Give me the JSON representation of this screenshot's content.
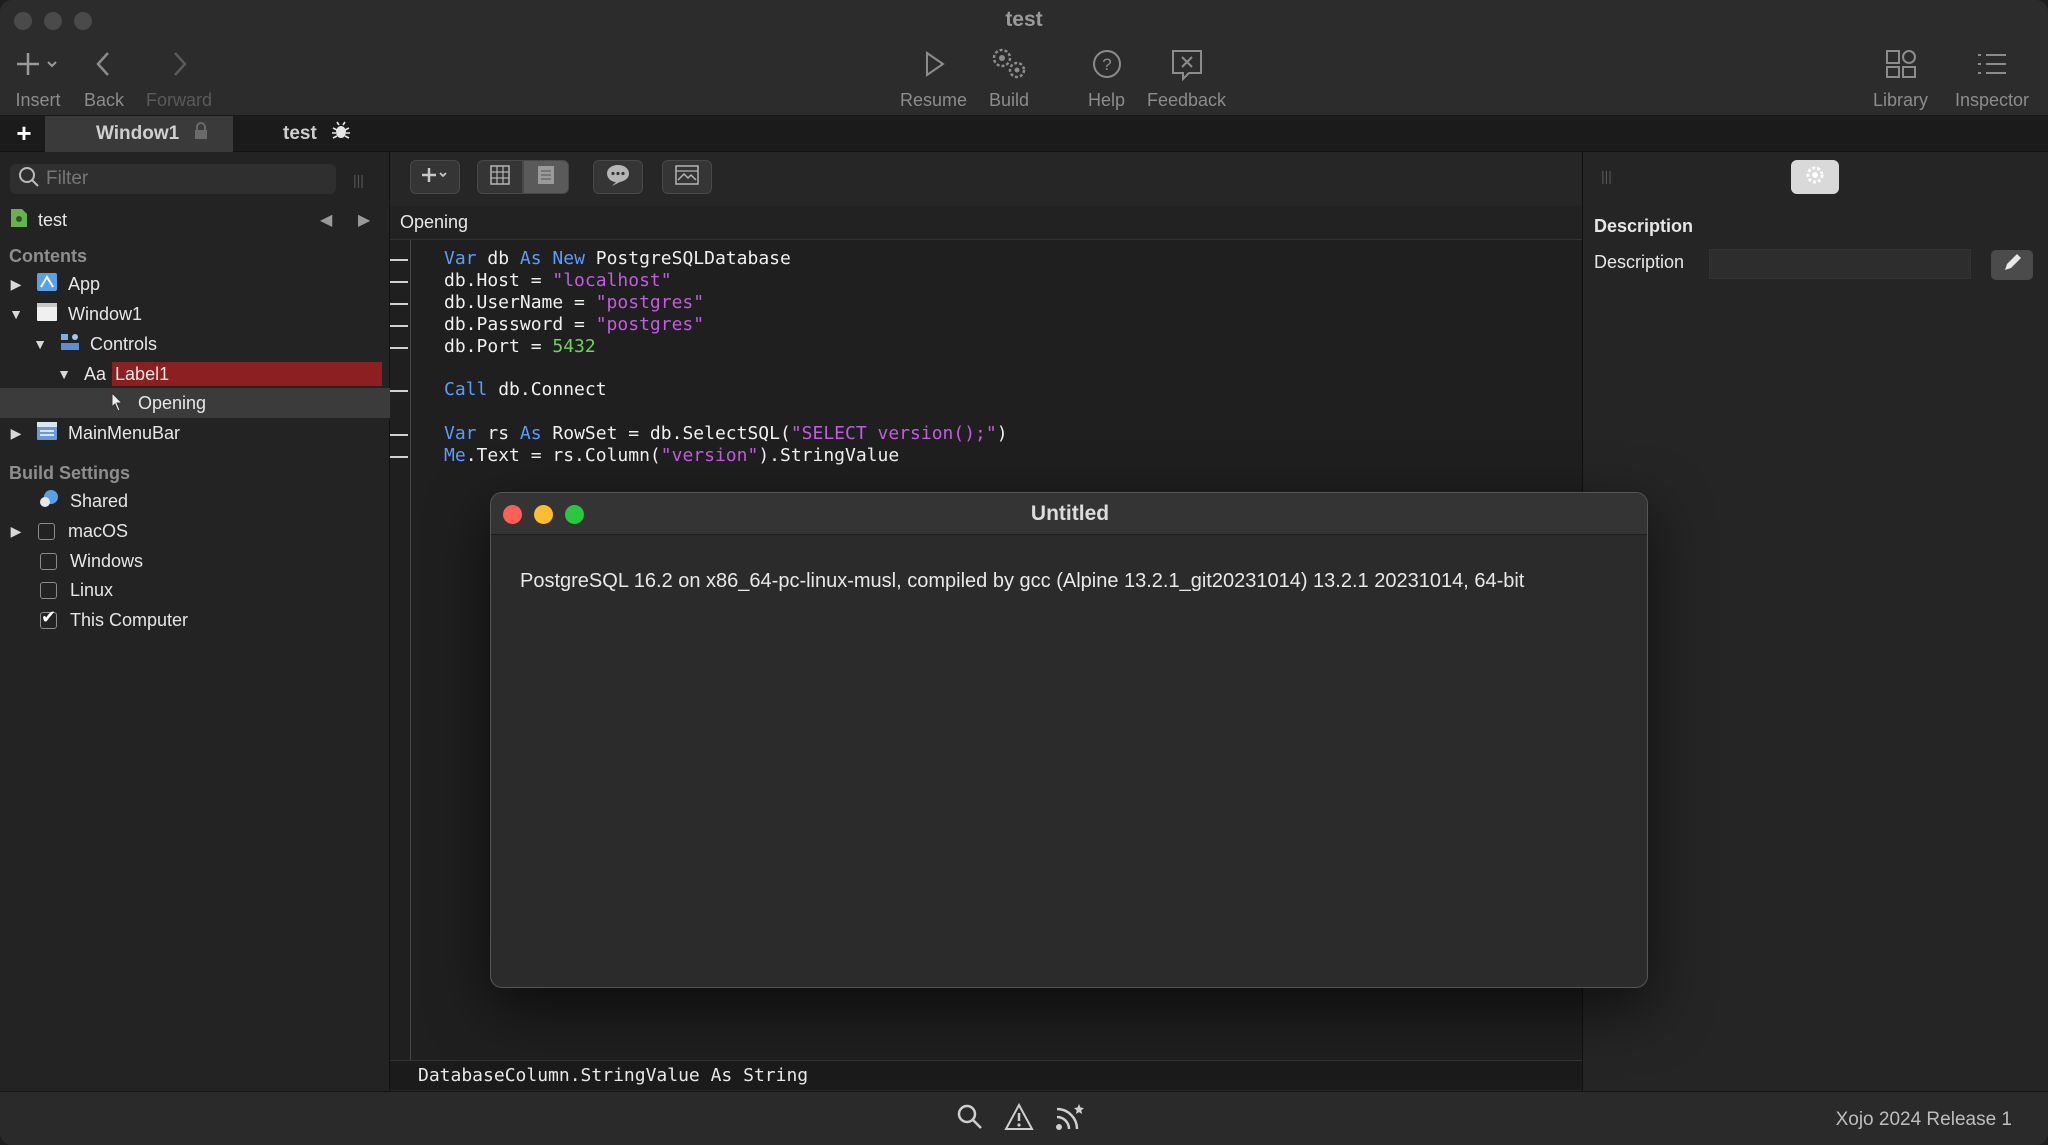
{
  "window": {
    "title": "test"
  },
  "toolbar": {
    "insert": "Insert",
    "back": "Back",
    "forward": "Forward",
    "resume": "Resume",
    "build": "Build",
    "help": "Help",
    "feedback": "Feedback",
    "library": "Library",
    "inspector": "Inspector"
  },
  "tabs": [
    {
      "label": "Window1",
      "icon": "lock-icon"
    },
    {
      "label": "test",
      "icon": "bug-icon"
    }
  ],
  "navigator": {
    "filter_placeholder": "Filter",
    "project": "test",
    "contents_header": "Contents",
    "items": {
      "app": "App",
      "window1": "Window1",
      "controls": "Controls",
      "label1_prefix": "Aa",
      "label1": "Label1",
      "opening": "Opening",
      "mainmenubar": "MainMenuBar"
    },
    "build_header": "Build Settings",
    "build": {
      "shared": "Shared",
      "macos": "macOS",
      "windows": "Windows",
      "linux": "Linux",
      "this_computer": "This Computer"
    }
  },
  "editor": {
    "path": "Opening",
    "code": {
      "l1": {
        "var": "Var",
        "db": " db ",
        "as": "As",
        "new": " New",
        "type": " PostgreSQLDatabase"
      },
      "l2": {
        "pre": "db.Host = ",
        "str": "\"localhost\""
      },
      "l3": {
        "pre": "db.UserName = ",
        "str": "\"postgres\""
      },
      "l4": {
        "pre": "db.Password = ",
        "str": "\"postgres\""
      },
      "l5": {
        "pre": "db.Port = ",
        "num": "5432"
      },
      "l6": {
        "call": "Call",
        "rest": " db.Connect"
      },
      "l7": {
        "var": "Var",
        "rs": " rs ",
        "as": "As",
        "mid": " RowSet = db.SelectSQL(",
        "str": "\"SELECT version();\"",
        "end": ")"
      },
      "l8": {
        "me": "Me",
        "mid": ".Text = rs.Column(",
        "str": "\"version\"",
        "end": ").StringValue"
      }
    },
    "status": "DatabaseColumn.StringValue As String"
  },
  "inspector": {
    "section_title": "Description",
    "field_label": "Description",
    "field_value": ""
  },
  "dialog": {
    "title": "Untitled",
    "message": "PostgreSQL 16.2 on x86_64-pc-linux-musl, compiled by gcc (Alpine 13.2.1_git20231014) 13.2.1 20231014, 64-bit"
  },
  "statusbar": {
    "version": "Xojo 2024 Release 1"
  },
  "colors": {
    "keyword": "#5b9cff",
    "string": "#c35ce0",
    "number": "#6ed35f",
    "selection": "#8c2020",
    "close": "#ff5f57",
    "minimize": "#febc2e",
    "zoom": "#28c840"
  }
}
